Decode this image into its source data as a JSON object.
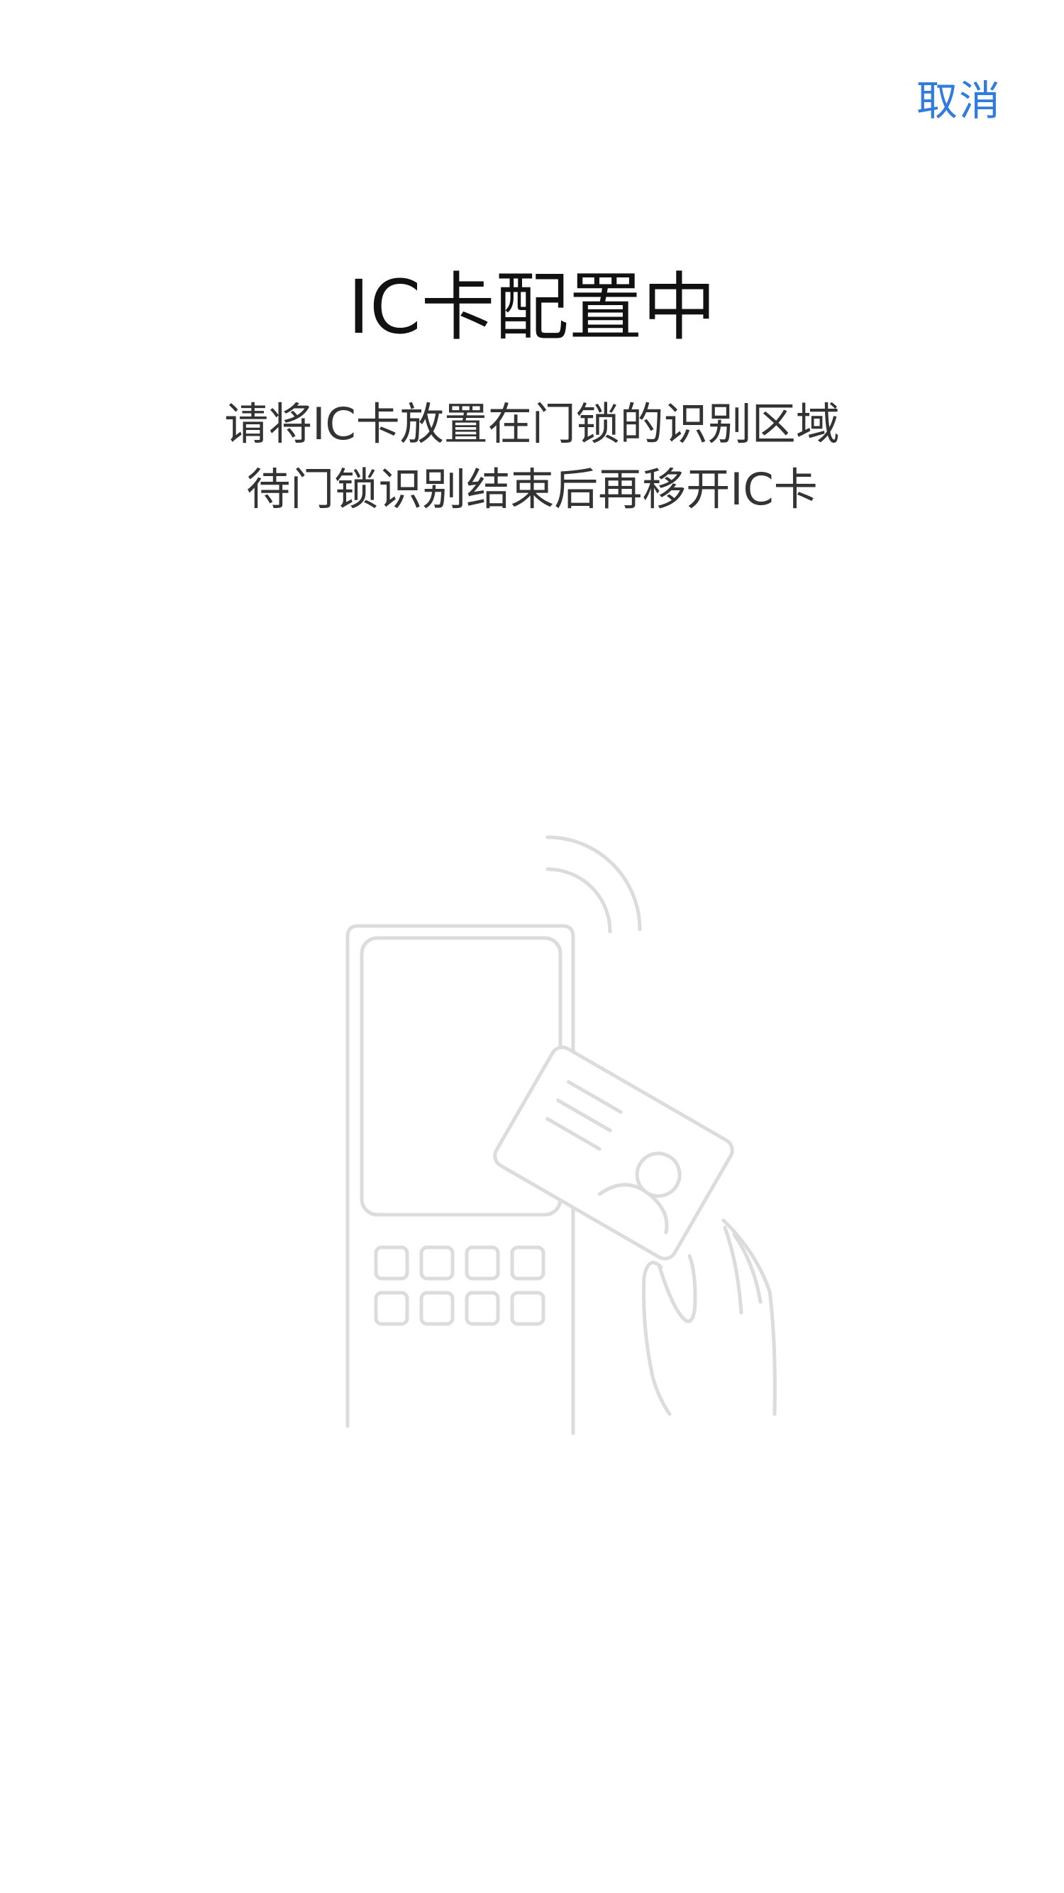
{
  "header": {
    "cancel_label": "取消"
  },
  "main": {
    "title": "IC卡配置中",
    "instruction_lines": [
      "请将IC卡放置在门锁的识别区域",
      "待门锁识别结束后再移开IC卡"
    ]
  },
  "illustration": {
    "icons": [
      "door-lock-icon",
      "ic-card-icon",
      "hand-icon",
      "wireless-signal-icon"
    ],
    "stroke_color": "#dcdcdc"
  },
  "colors": {
    "accent": "#2f7be0",
    "title_text": "#111111",
    "body_text": "#333333",
    "background": "#ffffff"
  }
}
